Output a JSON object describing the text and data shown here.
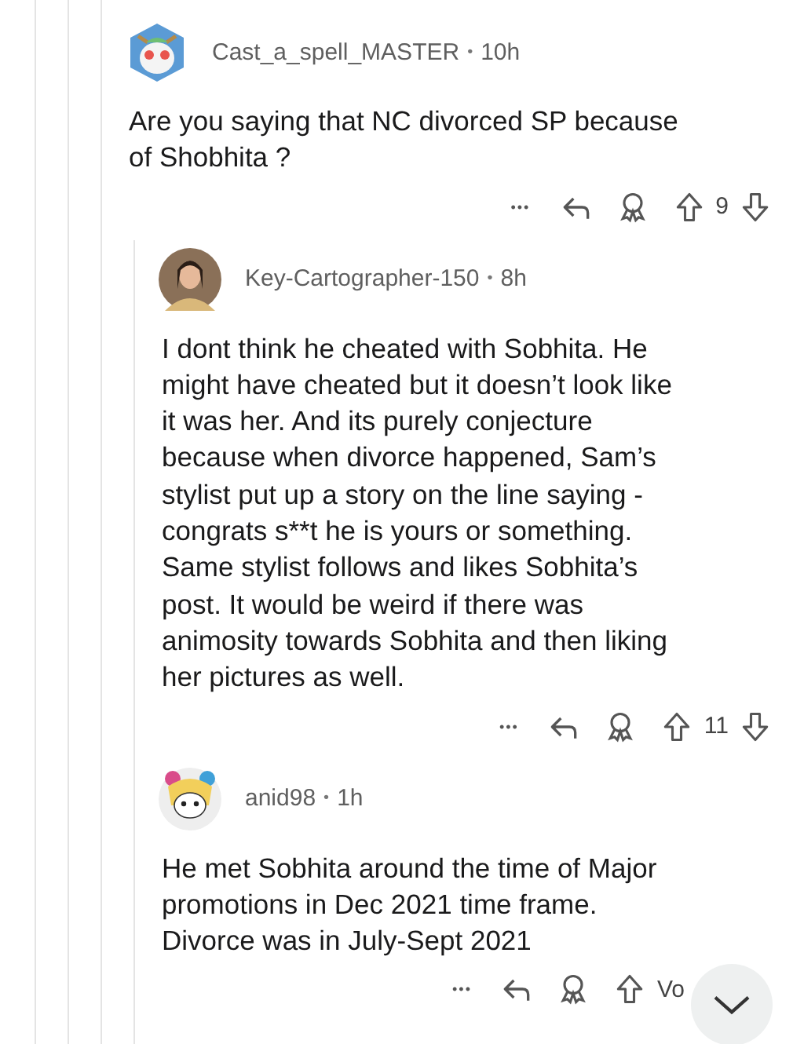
{
  "comments": [
    {
      "avatar": {
        "kind": "snoo"
      },
      "author": "Cast_a_spell_MASTER",
      "age": "10h",
      "lines": [
        "Are you saying that NC divorced SP because",
        "of Shobhita ?"
      ],
      "more": "•••",
      "score": "9",
      "children": [
        {
          "avatar": {
            "kind": "photo"
          },
          "author": "Key-Cartographer-150",
          "age": "8h",
          "lines": [
            "I dont think he cheated with Sobhita. He",
            "might have cheated but it doesn’t look like",
            "it was her. And its purely conjecture",
            "because when divorce happened, Sam’s",
            "stylist put up a story on the line saying -",
            "congrats s**t he is yours or something.",
            "Same stylist follows and likes Sobhita’s",
            "post. It would be weird if there was",
            "animosity towards Sobhita and then liking",
            "her pictures as well."
          ],
          "more": "•••",
          "score": "11"
        },
        {
          "avatar": {
            "kind": "snoo-hat"
          },
          "author": "anid98",
          "age": "1h",
          "lines": [
            "He met Sobhita around the time of Major",
            "promotions in Dec 2021 time frame.",
            "Divorce was in July-Sept 2021"
          ],
          "more": "•••",
          "score": "Vo",
          "covered_by_button": true
        }
      ]
    }
  ],
  "separator": "•",
  "scroll_button": {
    "kind": "chevron-down"
  }
}
